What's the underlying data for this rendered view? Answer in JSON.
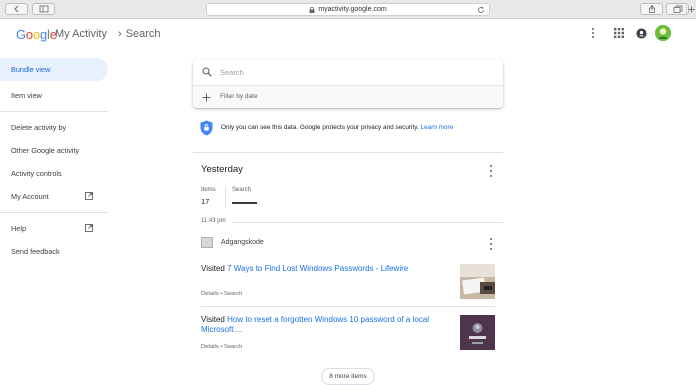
{
  "browser": {
    "url": "myactivity.google.com"
  },
  "header": {
    "logo": "Google",
    "product": "My Activity",
    "breadcrumb": "Search",
    "colors": {
      "blue": "#4285F4",
      "red": "#EA4335",
      "yellow": "#FBBC05",
      "green": "#34A853"
    }
  },
  "sidebar": {
    "items": [
      {
        "label": "Bundle view",
        "active": true
      },
      {
        "label": "Item view"
      },
      {
        "label": "Delete activity by"
      },
      {
        "label": "Other Google activity"
      },
      {
        "label": "Activity controls"
      },
      {
        "label": "My Account",
        "icon": "external-link-icon"
      },
      {
        "label": "Help",
        "icon": "external-link-icon"
      },
      {
        "label": "Send feedback"
      }
    ]
  },
  "search": {
    "placeholder": "Search",
    "filter_label": "Filter by date"
  },
  "privacy": {
    "text": "Only you can see this data. Google protects your privacy and security.",
    "link": "Learn more"
  },
  "day": {
    "title": "Yesterday",
    "stats": {
      "items_label": "Items",
      "items_count": "17",
      "search_label": "Search"
    },
    "time": "11:43 pm",
    "group_name": "Adgangskode",
    "entries": [
      {
        "prefix": "Visited",
        "link": "7 Ways to Find Lost Windows Passwords - Lifewire",
        "meta": "Details • Search"
      },
      {
        "prefix": "Visited",
        "link": "How to reset a forgotten Windows 10 password of a local Microsoft ...",
        "meta": "Details • Search"
      }
    ]
  },
  "more_button": "8 more items"
}
